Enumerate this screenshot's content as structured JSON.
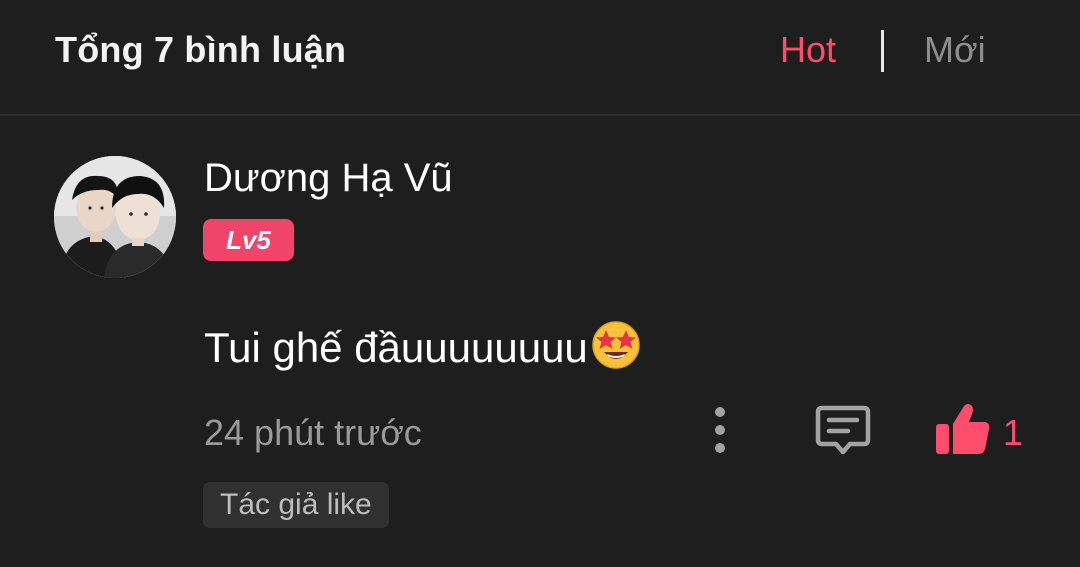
{
  "header": {
    "title": "Tổng 7 bình luận",
    "sort_hot": "Hot",
    "separator": "|",
    "sort_new": "Mới",
    "active_sort": "Hot",
    "accent_color": "#ff4d6d"
  },
  "comment": {
    "username": "Dương Hạ Vũ",
    "level": "Lv5",
    "text": "Tui ghế đầuuuuuuuu",
    "emoji": "star-struck-emoji",
    "time": "24 phút trước",
    "likes": "1",
    "author_like_label": "Tác giả like",
    "icons": {
      "more": "more-vertical-icon",
      "reply": "comment-icon",
      "like": "thumbs-up-icon"
    }
  }
}
